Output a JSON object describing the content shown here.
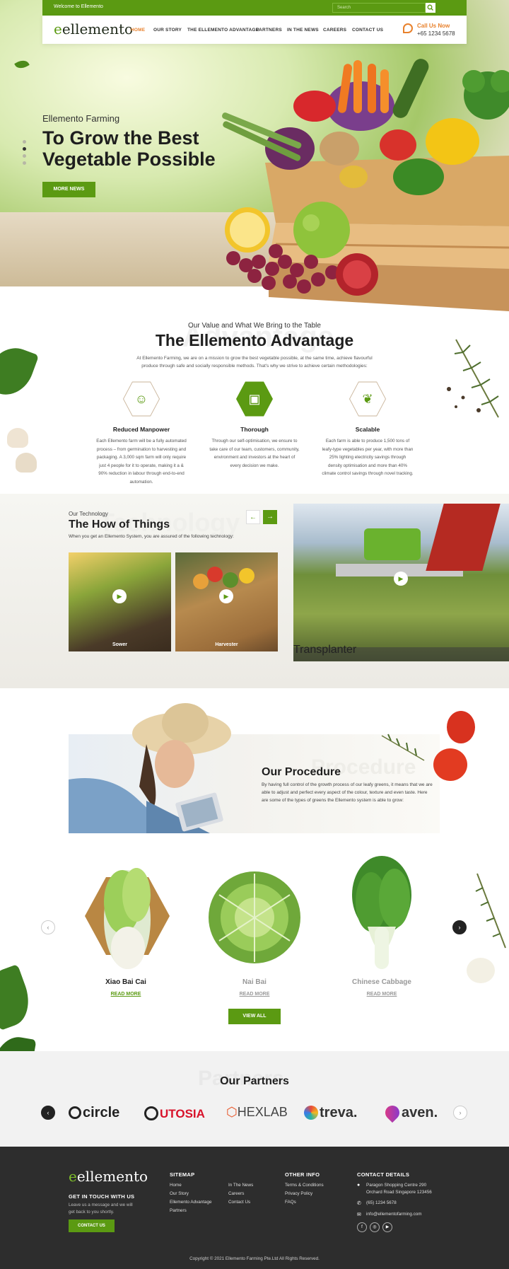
{
  "topbar": {
    "welcome": "Welcome to Ellemento",
    "search_placeholder": "Search"
  },
  "header": {
    "logo": "ellemento",
    "nav": [
      "HOME",
      "OUR STORY",
      "THE ELLEMENTO ADVANTAGE",
      "PARTNERS",
      "IN THE NEWS",
      "CAREERS",
      "CONTACT US"
    ],
    "call_label": "Call Us Now",
    "call_number": "+65 1234 5678"
  },
  "hero": {
    "kicker": "Ellemento Farming",
    "title": "To Grow the Best Vegetable Possible",
    "button": "MORE NEWS"
  },
  "advantage": {
    "ghost": "Advantage",
    "kicker": "Our Value and What We Bring to the Table",
    "title": "The Ellemento Advantage",
    "description": "At Ellemento Farming, we are on a mission to grow the best vegetable possible, at the same time, achieve flavourful produce through safe and socially responsible methods. That's why we strive to achieve certain methodologies:",
    "features": [
      {
        "icon": "farmer-icon",
        "title": "Reduced Manpower",
        "text": "Each Ellemento farm will be a fully automated process – from germination to harvesting and packaging. A 3,000 sqm farm will only require just 4 people for it to operate, making it a & 90% reduction in labour through end-to-end automation."
      },
      {
        "icon": "presentation-icon",
        "title": "Thorough",
        "text": "Through our self-optimisation, we ensure to take care of our team, customers, community, environment and investors at the heart of every decision we make."
      },
      {
        "icon": "sprout-icon",
        "title": "Scalable",
        "text": "Each farm is able to produce 1,500 tons of leafy-type vegetables per year, with more than 25% lighting electricity savings through density optimisation and more than 40% climate control savings through novel tracking."
      }
    ]
  },
  "technology": {
    "ghost": "Technology",
    "kicker": "Our Technology",
    "title": "The How of Things",
    "description": "When you get an Ellemento System, you are assured of the following technology:",
    "cards": [
      "Sower",
      "Harvester",
      "Transplanter"
    ]
  },
  "procedure": {
    "ghost": "Procedure",
    "title": "Our Procedure",
    "description": "By having full control of the growth process of our leafy greens, it means that we are able to adjust and perfect every aspect of the colour, texture and even taste. Here are some of the types of greens the Ellemento system is able to grow:"
  },
  "products": {
    "items": [
      {
        "name": "Xiao Bai Cai",
        "link": "READ MORE"
      },
      {
        "name": "Nai Bai",
        "link": "READ MORE"
      },
      {
        "name": "Chinese Cabbage",
        "link": "READ MORE"
      }
    ],
    "view_all": "VIEW ALL"
  },
  "partners": {
    "ghost": "Partners",
    "title": "Our Partners",
    "logos": [
      "circle",
      "UTOSIA",
      "HEXLAB",
      "treva.",
      "aven."
    ]
  },
  "footer": {
    "logo": "ellemento",
    "touch_title": "GET IN TOUCH WITH US",
    "touch_text": "Leave us a message and we will get back to you shortly.",
    "contact_button": "CONTACT US",
    "sitemap_title": "SITEMAP",
    "sitemap_col1": [
      "Home",
      "Our Story",
      "Ellemento Advantage",
      "Partners"
    ],
    "sitemap_col2": [
      "In The News",
      "Careers",
      "Contact Us"
    ],
    "other_title": "OTHER INFO",
    "other_links": [
      "Terms & Conditions",
      "Privacy Policy",
      "FAQs"
    ],
    "contact_title": "CONTACT DETAILS",
    "address_line1": "Paragon Shopping Centre 290",
    "address_line2": "Orchard Road Singapore 123456",
    "phone": "(65) 1234 5678",
    "email": "info@ellementofarming.com",
    "copyright": "Copyright © 2021 Ellemento Farming Pte.Ltd All Rights Reserved."
  },
  "colors": {
    "brand_green": "#5b9a12",
    "accent_orange": "#e8812c",
    "footer_bg": "#2d2d2d"
  }
}
